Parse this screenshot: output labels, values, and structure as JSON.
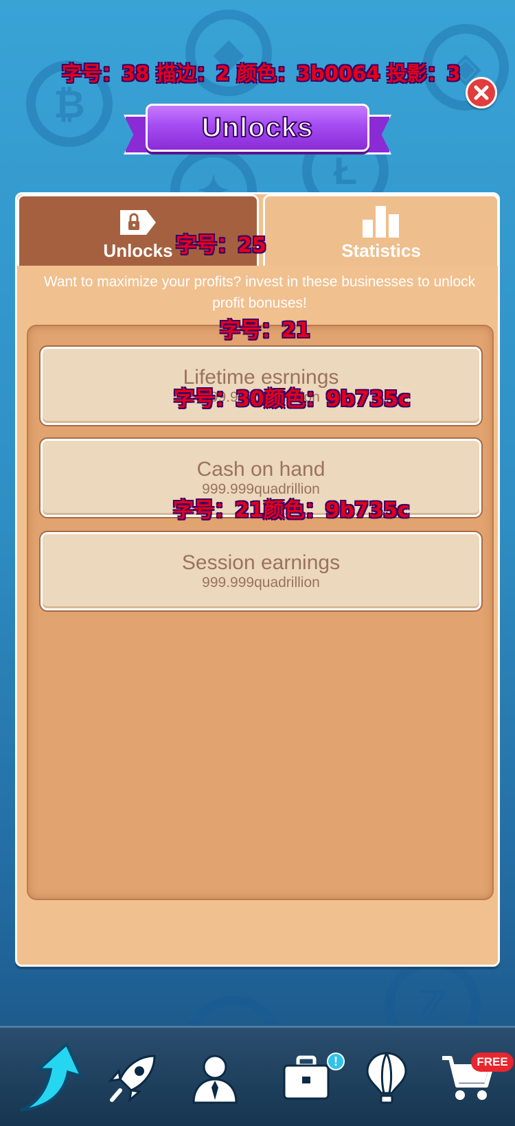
{
  "annotations": {
    "top": "字号：38 描边：2 颜色：3b0064 投影：3",
    "tab": "字号：25",
    "description": "字号：21",
    "card_title": "字号：30颜色：9b735c",
    "card_value": "字号：21颜色：9b735c"
  },
  "header": {
    "title": "Unlocks",
    "close_icon": "close-icon"
  },
  "tabs": [
    {
      "label": "Unlocks",
      "icon": "lock-tag-icon",
      "active": true
    },
    {
      "label": "Statistics",
      "icon": "bar-chart-icon",
      "active": false
    }
  ],
  "description": "Want to maximize your profits? invest in these businesses to unlock profit bonuses!",
  "stats": [
    {
      "title": "Lifetime esrnings",
      "value": "999.999quadrillion"
    },
    {
      "title": "Cash on hand",
      "value": "999.999quadrillion"
    },
    {
      "title": "Session earnings",
      "value": "999.999quadrillion"
    }
  ],
  "bottom_nav": {
    "items": [
      {
        "icon": "level-up-arrow-icon"
      },
      {
        "icon": "rocket-icon"
      },
      {
        "icon": "manager-icon"
      },
      {
        "icon": "briefcase-icon",
        "badge": "!"
      },
      {
        "icon": "hot-air-balloon-icon"
      },
      {
        "icon": "shopping-cart-icon",
        "badge": "FREE"
      }
    ]
  },
  "colors": {
    "annotation_red": "#e3001b",
    "stroke_purple": "#3b0064",
    "card_text": "#9b735c",
    "ribbon_purple": "#a44cf2",
    "tab_active": "#a5613f"
  }
}
